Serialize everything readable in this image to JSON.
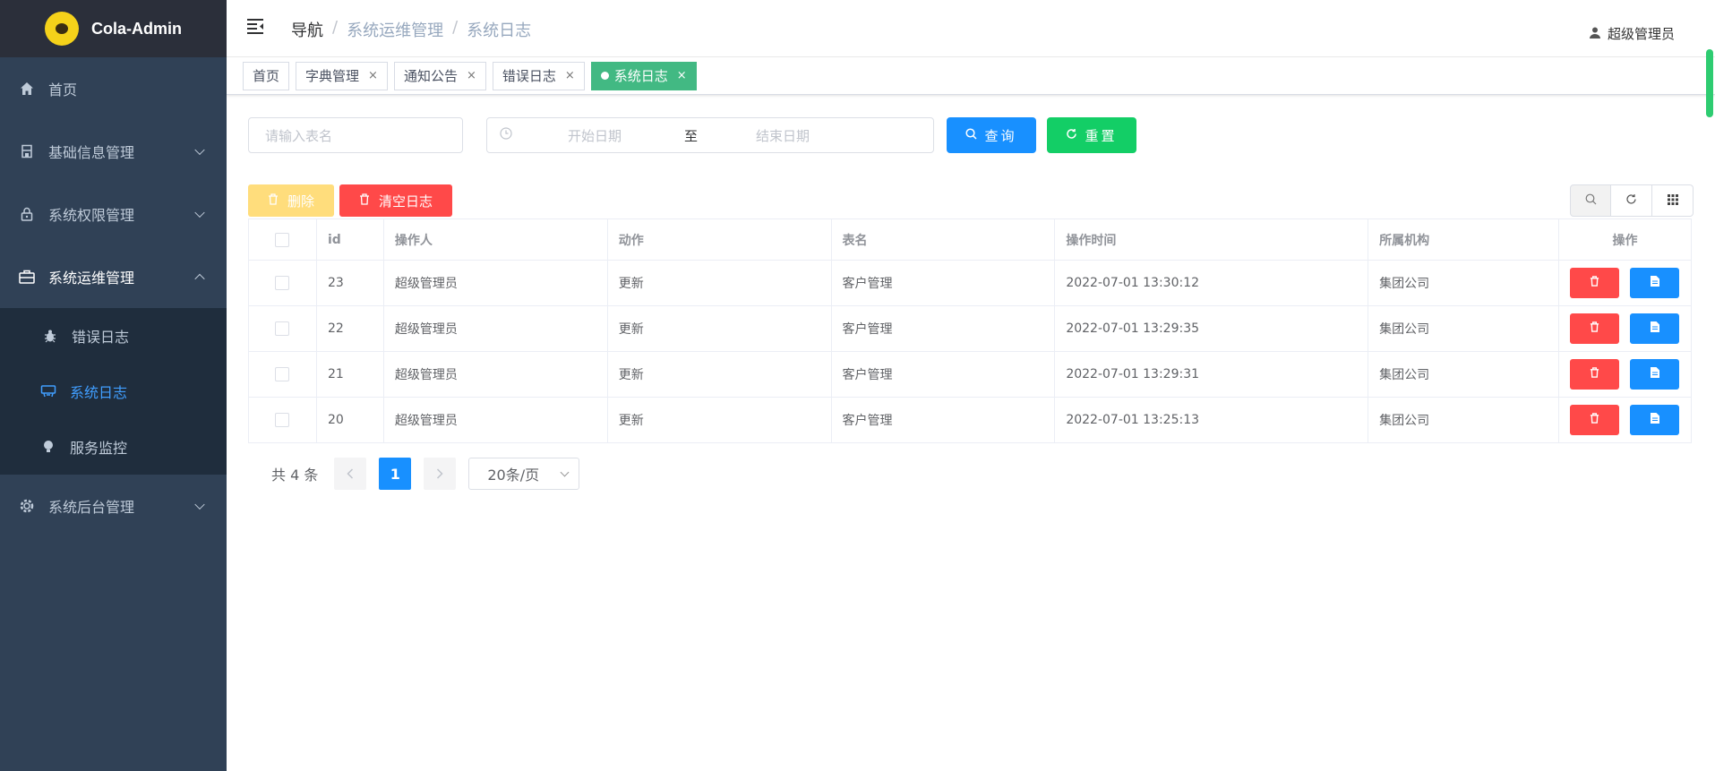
{
  "app": {
    "title": "Cola-Admin"
  },
  "sidebar": {
    "items": [
      {
        "label": "首页",
        "icon": "home-icon"
      },
      {
        "label": "基础信息管理",
        "icon": "building-icon"
      },
      {
        "label": "系统权限管理",
        "icon": "lock-icon"
      },
      {
        "label": "系统运维管理",
        "icon": "toolbox-icon"
      },
      {
        "label": "系统后台管理",
        "icon": "gear-icon"
      }
    ],
    "submenu": [
      {
        "label": "错误日志",
        "icon": "bug-icon"
      },
      {
        "label": "系统日志",
        "icon": "log-icon"
      },
      {
        "label": "服务监控",
        "icon": "bulb-icon"
      }
    ]
  },
  "header": {
    "breadcrumb": [
      "导航",
      "系统运维管理",
      "系统日志"
    ],
    "separator": "/",
    "user": "超级管理员"
  },
  "tags": [
    {
      "label": "首页"
    },
    {
      "label": "字典管理",
      "close": "×"
    },
    {
      "label": "通知公告",
      "close": "×"
    },
    {
      "label": "错误日志",
      "close": "×"
    },
    {
      "label": "系统日志",
      "close": "×"
    }
  ],
  "search": {
    "table_name_placeholder": "请输入表名",
    "start_placeholder": "开始日期",
    "range_separator": "至",
    "end_placeholder": "结束日期",
    "query_label": "查询",
    "reset_label": "重置"
  },
  "toolbar": {
    "delete_label": "删除",
    "clear_label": "清空日志"
  },
  "table": {
    "columns": [
      "id",
      "操作人",
      "动作",
      "表名",
      "操作时间",
      "所属机构",
      "操作"
    ],
    "rows": [
      {
        "id": "23",
        "operator": "超级管理员",
        "action": "更新",
        "table": "客户管理",
        "time": "2022-07-01 13:30:12",
        "org": "集团公司"
      },
      {
        "id": "22",
        "operator": "超级管理员",
        "action": "更新",
        "table": "客户管理",
        "time": "2022-07-01 13:29:35",
        "org": "集团公司"
      },
      {
        "id": "21",
        "operator": "超级管理员",
        "action": "更新",
        "table": "客户管理",
        "time": "2022-07-01 13:29:31",
        "org": "集团公司"
      },
      {
        "id": "20",
        "operator": "超级管理员",
        "action": "更新",
        "table": "客户管理",
        "time": "2022-07-01 13:25:13",
        "org": "集团公司"
      }
    ]
  },
  "pagination": {
    "total": "共 4 条",
    "current": "1",
    "page_size": "20条/页"
  },
  "colors": {
    "sidebar_bg": "#304156",
    "active_tag": "#42b983",
    "primary": "#1890ff",
    "success": "#13ce66",
    "danger": "#ff4949",
    "warning_light": "#ffdd7c",
    "menu_active": "#409eff"
  }
}
